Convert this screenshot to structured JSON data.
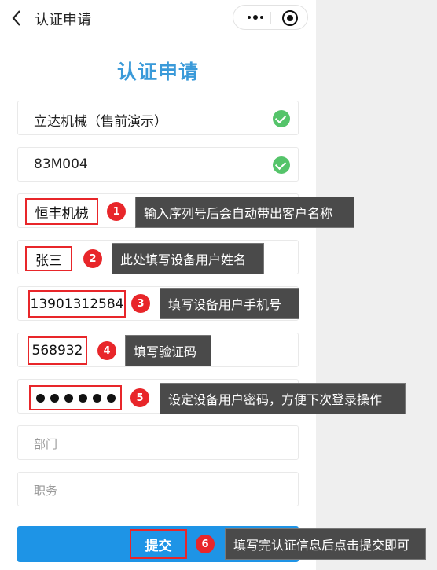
{
  "navbar": {
    "title": "认证申请"
  },
  "page": {
    "title": "认证申请"
  },
  "fields": {
    "company": "立达机械（售前演示）",
    "serial": "83M004",
    "customer": "恒丰机械",
    "user_name": "张三",
    "phone": "13901312584",
    "code": "568932",
    "department_placeholder": "部门",
    "position_placeholder": "职务"
  },
  "annotations": [
    {
      "num": "1",
      "text": "输入序列号后会自动带出客户名称"
    },
    {
      "num": "2",
      "text": "此处填写设备用户姓名"
    },
    {
      "num": "3",
      "text": "填写设备用户手机号"
    },
    {
      "num": "4",
      "text": "填写验证码"
    },
    {
      "num": "5",
      "text": "设定设备用户密码，方便下次登录操作"
    },
    {
      "num": "6",
      "text": "填写完认证信息后点击提交即可"
    }
  ],
  "submit": {
    "label": "提交"
  },
  "colors": {
    "title_blue": "#3a9ad9",
    "button_blue": "#1e94e6",
    "highlight_red": "#e8262a",
    "check_green": "#55c46a",
    "tooltip_gray": "#4a4a4a"
  },
  "icons": [
    "back-arrow-icon",
    "more-icon",
    "close-circle-icon",
    "check-icon",
    "eye-icon"
  ]
}
